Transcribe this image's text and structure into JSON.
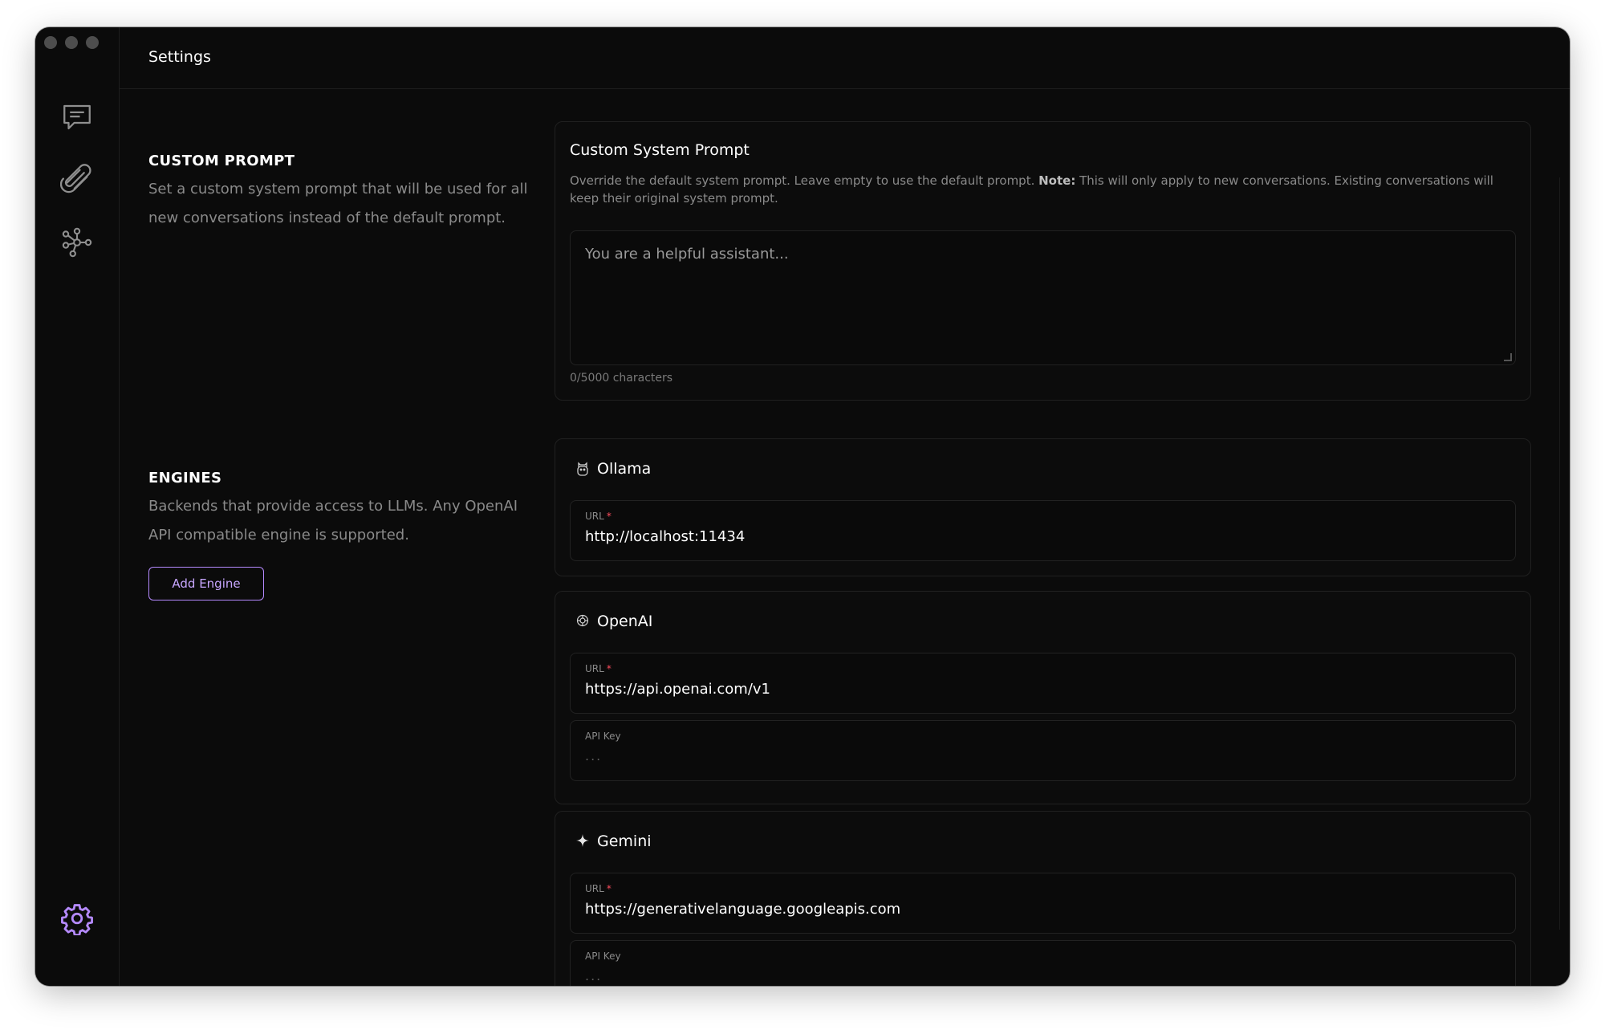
{
  "app": {
    "header_title": "Settings",
    "sidebar_icons": [
      "chat-icon",
      "attachment-icon",
      "network-icon",
      "settings-icon"
    ],
    "accent_color": "#b58aff"
  },
  "custom_prompt": {
    "section_title": "CUSTOM PROMPT",
    "section_desc": "Set a custom system prompt that will be used for all new conversations instead of the default prompt.",
    "card_title": "Custom System Prompt",
    "card_desc_prefix": "Override the default system prompt. Leave empty to use the default prompt. ",
    "card_desc_note_label": "Note:",
    "card_desc_suffix": " This will only apply to new conversations. Existing conversations will keep their original system prompt.",
    "textarea_placeholder": "You are a helpful assistant...",
    "char_count": "0/5000 characters"
  },
  "engines": {
    "section_title": "ENGINES",
    "section_desc": "Backends that provide access to LLMs. Any OpenAI API compatible engine is supported.",
    "add_button": "Add Engine",
    "items": [
      {
        "name": "Ollama",
        "icon": "ollama-icon",
        "url_label": "URL",
        "url_value": "http://localhost:11434"
      },
      {
        "name": "OpenAI",
        "icon": "openai-icon",
        "url_label": "URL",
        "url_value": "https://api.openai.com/v1",
        "api_key_label": "API Key",
        "api_key_placeholder": "..."
      },
      {
        "name": "Gemini",
        "icon": "sparkle-icon",
        "url_label": "URL",
        "url_value": "https://generativelanguage.googleapis.com",
        "api_key_label": "API Key",
        "api_key_placeholder": "..."
      }
    ]
  }
}
